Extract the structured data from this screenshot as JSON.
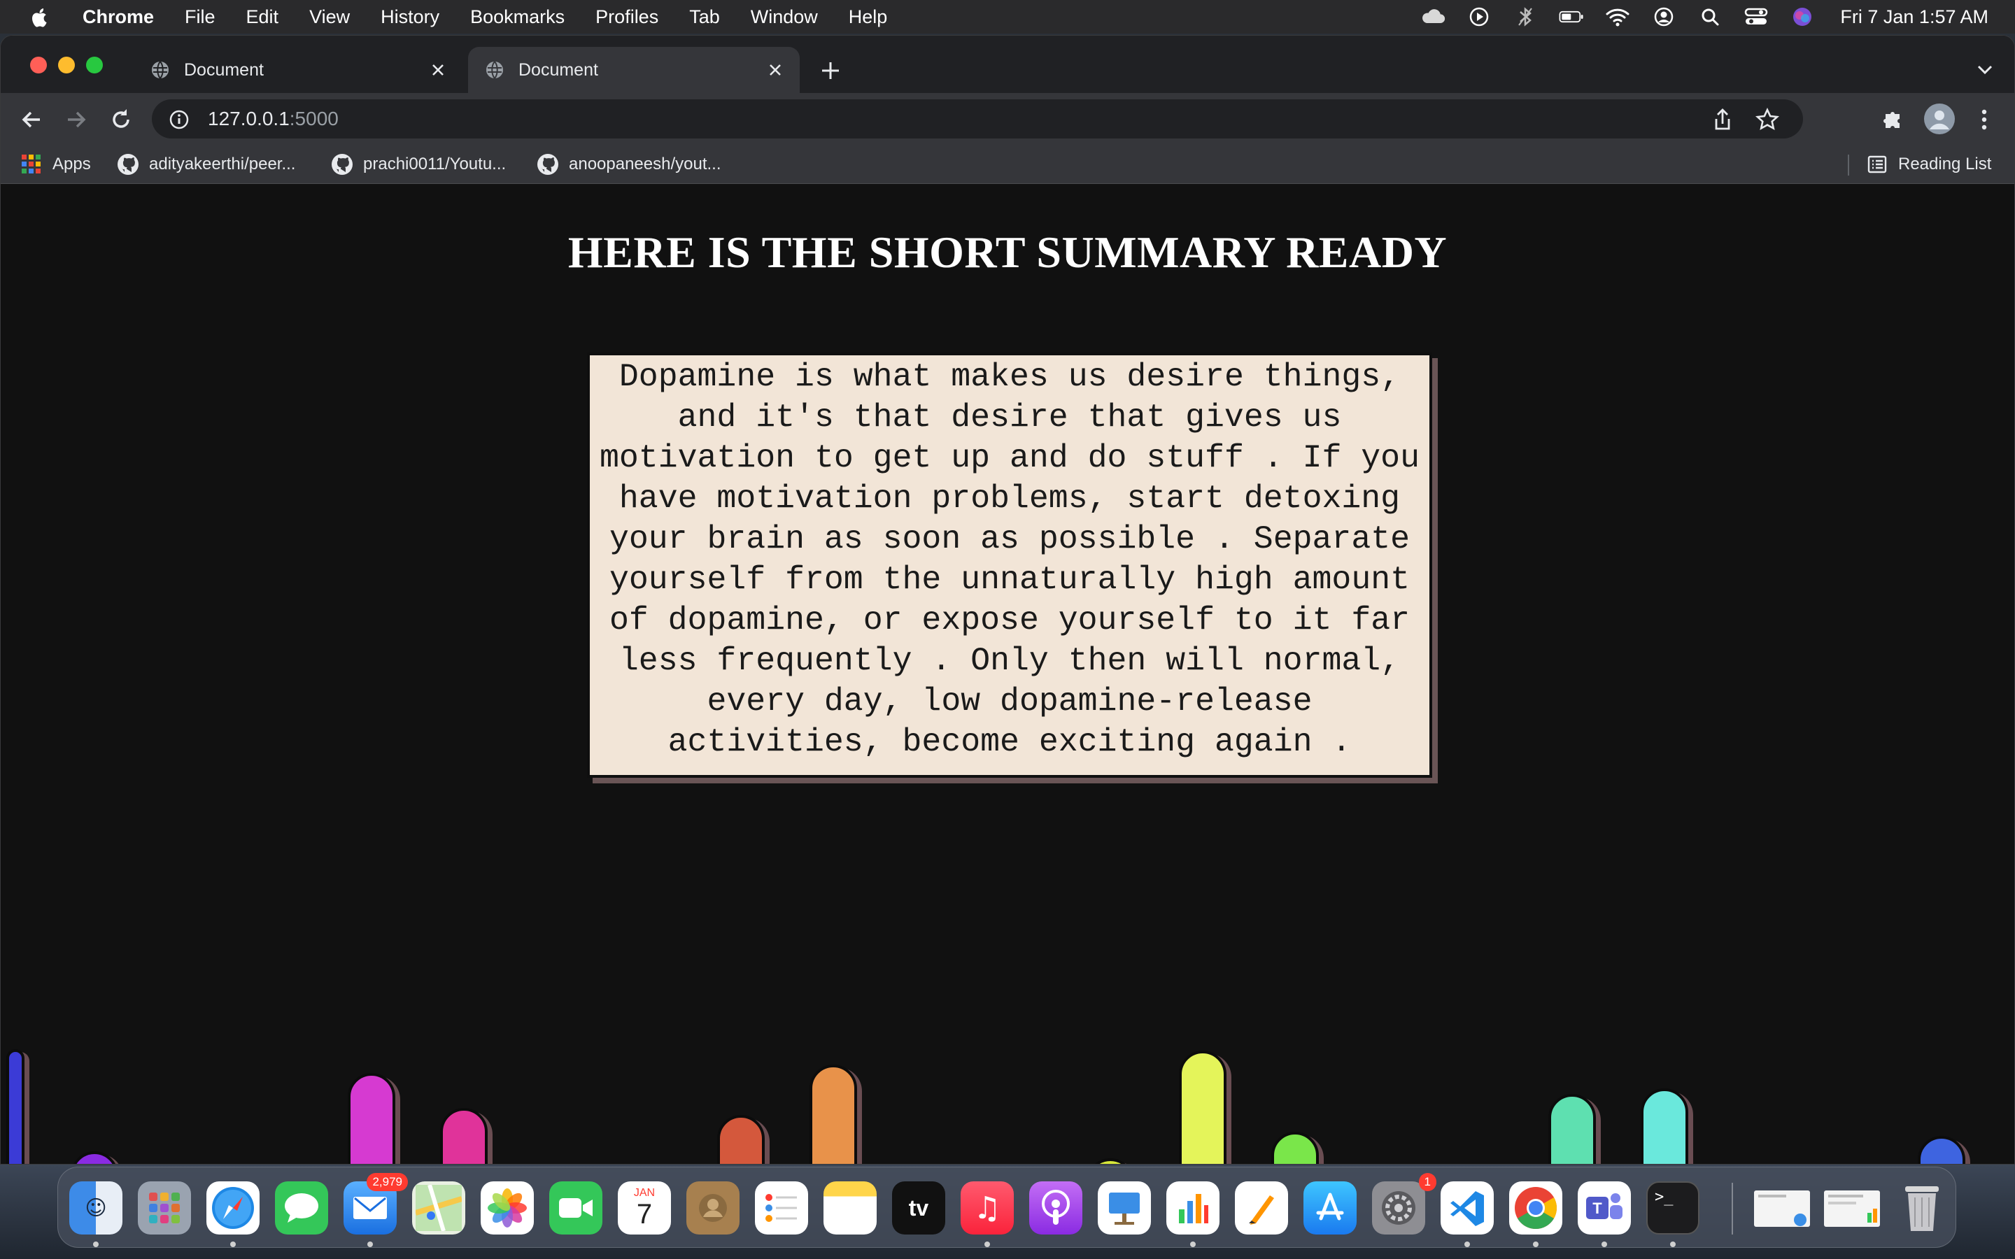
{
  "menubar": {
    "app_name": "Chrome",
    "menus": [
      "File",
      "Edit",
      "View",
      "History",
      "Bookmarks",
      "Profiles",
      "Tab",
      "Window",
      "Help"
    ],
    "clock": "Fri 7 Jan  1:57 AM",
    "status_icons": [
      "cloud-icon",
      "play-icon",
      "bluetooth-icon",
      "battery-icon",
      "wifi-icon",
      "user-icon",
      "search-icon",
      "control-center-icon",
      "siri-icon"
    ]
  },
  "browser": {
    "tabs": [
      {
        "title": "Document",
        "active": false
      },
      {
        "title": "Document",
        "active": true
      }
    ],
    "url_host": "127.0.0.1",
    "url_port": ":5000",
    "bookmarks": [
      {
        "label": "Apps",
        "icon": "apps-grid-icon"
      },
      {
        "label": "adityakeerthi/peer...",
        "icon": "github-icon"
      },
      {
        "label": "prachi0011/Youtu...",
        "icon": "github-icon"
      },
      {
        "label": "anoopaneesh/yout...",
        "icon": "github-icon"
      }
    ],
    "reading_list": "Reading List"
  },
  "page": {
    "title": "HERE IS THE SHORT SUMMARY READY",
    "summary": "Dopamine is what makes us desire things, and it's that desire that gives us motivation to get up and do stuff . If you have motivation problems, start detoxing your brain as soon as possible . Separate yourself from the unnaturally high amount of dopamine, or expose yourself to it far less frequently . Only then will normal, every day, low dopamine-release activities, become exciting again ."
  },
  "decorative_bars": [
    {
      "color": "#3b3bd6"
    },
    {
      "color": "#8a2be2"
    },
    {
      "color": "#c026d3"
    },
    {
      "color": "#d63ad1"
    },
    {
      "color": "#e0339a"
    },
    {
      "color": "#d4583c"
    },
    {
      "color": "#e8924a"
    },
    {
      "color": "#d9a43c"
    },
    {
      "color": "#d8e83a"
    },
    {
      "color": "#e4f45a"
    },
    {
      "color": "#7ae64a"
    },
    {
      "color": "#5ee0b0"
    },
    {
      "color": "#6ae8dc"
    },
    {
      "color": "#6ab0f0"
    },
    {
      "color": "#3e64e0"
    }
  ],
  "dock": {
    "mail_badge": "2,979",
    "settings_badge": "1",
    "calendar_month": "JAN",
    "calendar_day": "7",
    "tv_label": "tv",
    "apps": [
      "finder-icon",
      "launchpad-icon",
      "safari-icon",
      "messages-icon",
      "mail-icon",
      "maps-icon",
      "photos-icon",
      "facetime-icon",
      "calendar-icon",
      "contacts-icon",
      "reminders-icon",
      "notes-icon",
      "apple-tv-icon",
      "music-icon",
      "podcasts-icon",
      "keynote-icon",
      "numbers-icon",
      "pages-icon",
      "app-store-icon",
      "system-preferences-icon",
      "vscode-icon",
      "chrome-icon",
      "teams-icon",
      "terminal-icon",
      "screenshot-icon",
      "screenshot-icon",
      "trash-icon"
    ]
  }
}
